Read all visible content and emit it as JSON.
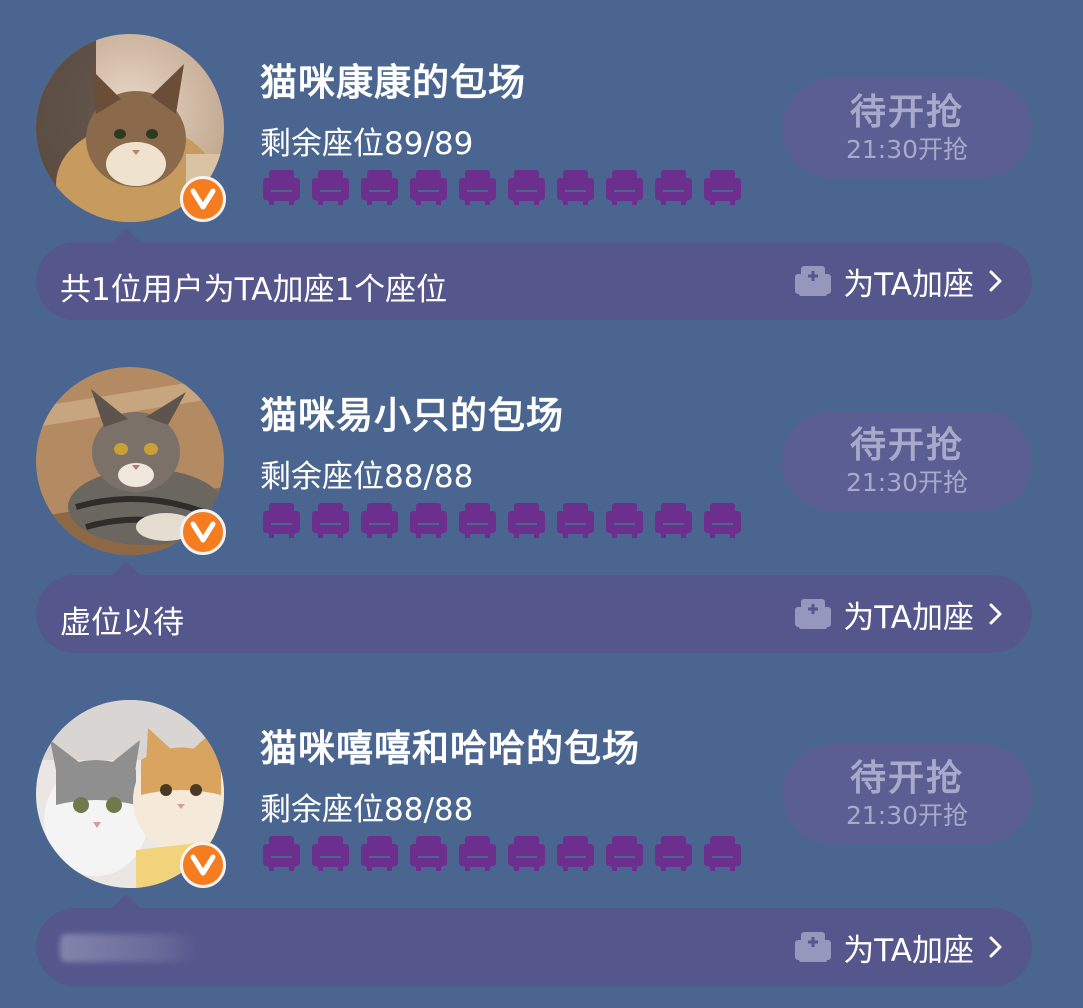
{
  "colors": {
    "background": "#4a6690",
    "card_pill": "#55568c",
    "button_bg": "#5a5e92",
    "button_text": "#a7abc9",
    "seat_purple": "#6d2f8e",
    "badge_orange": "#f57c1f"
  },
  "rooms": [
    {
      "title": "猫咪康康的包场",
      "seats_text": "剩余座位89/89",
      "seat_icon_count": 10,
      "button_main": "待开抢",
      "button_time": "21:30开抢",
      "info_text": "共1位用户为TA加座1个座位",
      "add_seat_label": "为TA加座",
      "avatar_icon": "cat-photo",
      "badge_icon": "verified-v-icon"
    },
    {
      "title": "猫咪易小只的包场",
      "seats_text": "剩余座位88/88",
      "seat_icon_count": 10,
      "button_main": "待开抢",
      "button_time": "21:30开抢",
      "info_text": "虚位以待",
      "add_seat_label": "为TA加座",
      "avatar_icon": "cat-photo",
      "badge_icon": "verified-v-icon"
    },
    {
      "title": "猫咪嘻嘻和哈哈的包场",
      "seats_text": "剩余座位88/88",
      "seat_icon_count": 10,
      "button_main": "待开抢",
      "button_time": "21:30开抢",
      "info_text": "",
      "add_seat_label": "为TA加座",
      "avatar_icon": "cat-photo",
      "badge_icon": "verified-v-icon"
    }
  ]
}
